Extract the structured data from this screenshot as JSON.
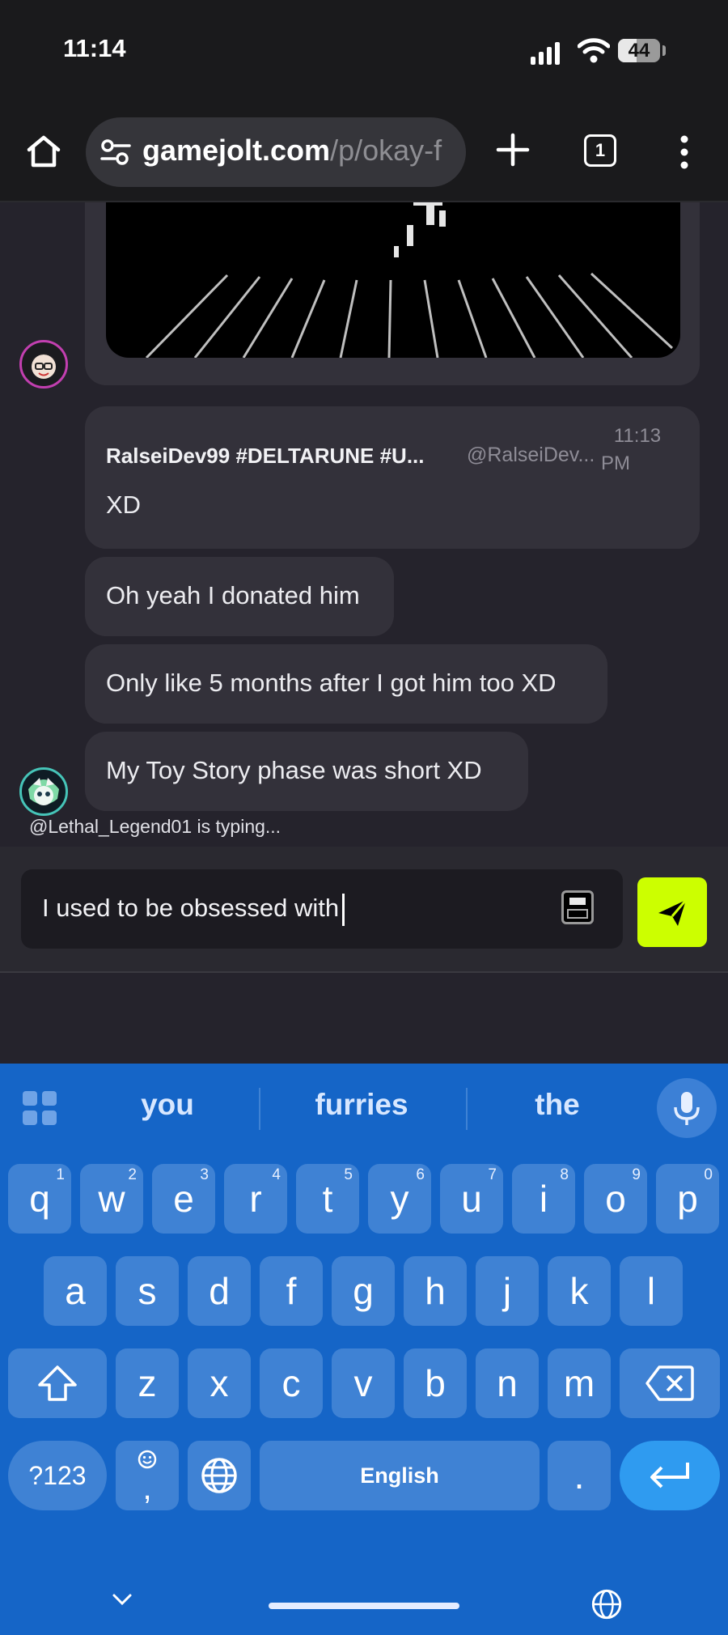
{
  "status_bar": {
    "time": "11:14",
    "battery_percent": "44",
    "battery_level": 0.44
  },
  "browser": {
    "url_domain": "gamejolt.com",
    "url_path": "/p/okay-f",
    "tab_count": "1"
  },
  "chat": {
    "reply_card": {
      "author": "RalseiDev99 #DELTARUNE #U...",
      "handle": "@RalseiDev...",
      "time_line1": "11:13",
      "time_line2": "PM",
      "text": "XD"
    },
    "messages": [
      {
        "text": "Oh yeah I donated him"
      },
      {
        "text": "Only like 5 months after I got him too XD"
      },
      {
        "text": "My Toy Story phase was short XD"
      }
    ],
    "typing_indicator": "@Lethal_Legend01 is typing..."
  },
  "composer": {
    "value": "I used to be obsessed with",
    "accent_color": "#ccff00"
  },
  "keyboard": {
    "suggestions": [
      "you",
      "furries",
      "the"
    ],
    "row1": [
      {
        "k": "q",
        "n": "1"
      },
      {
        "k": "w",
        "n": "2"
      },
      {
        "k": "e",
        "n": "3"
      },
      {
        "k": "r",
        "n": "4"
      },
      {
        "k": "t",
        "n": "5"
      },
      {
        "k": "y",
        "n": "6"
      },
      {
        "k": "u",
        "n": "7"
      },
      {
        "k": "i",
        "n": "8"
      },
      {
        "k": "o",
        "n": "9"
      },
      {
        "k": "p",
        "n": "0"
      }
    ],
    "row2": [
      "a",
      "s",
      "d",
      "f",
      "g",
      "h",
      "j",
      "k",
      "l"
    ],
    "row3": [
      "z",
      "x",
      "c",
      "v",
      "b",
      "n",
      "m"
    ],
    "symbols_label": "?123",
    "emoji_comma": ",",
    "space_label": "English",
    "period_label": ".",
    "color": "#1565c7"
  }
}
